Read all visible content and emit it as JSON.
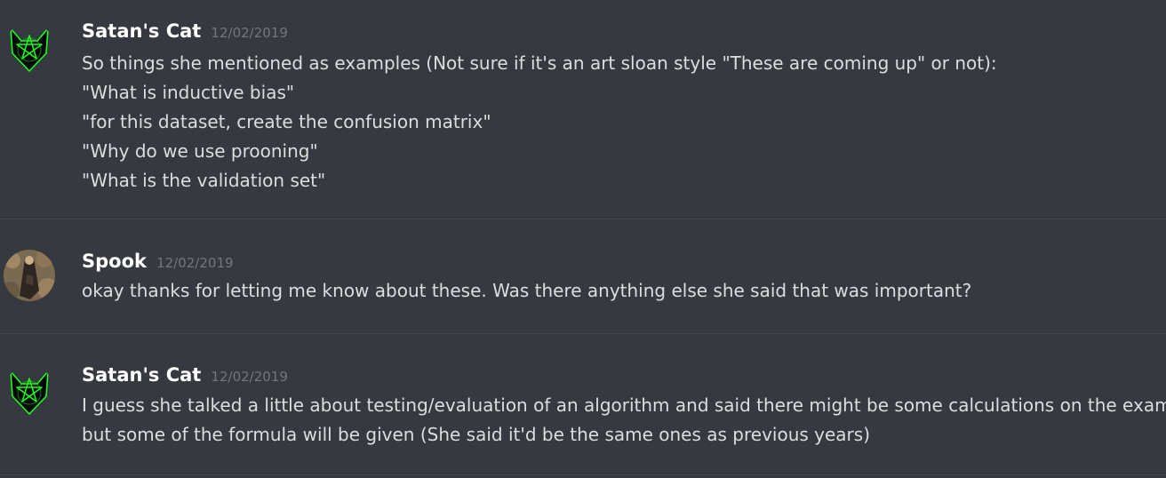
{
  "messages": [
    {
      "author": "Satan's Cat",
      "timestamp": "12/02/2019",
      "avatar_icon": "green-pentagram-cat-icon",
      "lines": [
        "So things she mentioned as examples (Not sure if it's an art sloan style \"These are coming up\" or not):",
        "\"What is inductive bias\"",
        "\"for this dataset, create the confusion matrix\"",
        "\"Why do we use prooning\"",
        "\"What is the validation set\""
      ]
    },
    {
      "author": "Spook",
      "timestamp": "12/02/2019",
      "avatar_icon": "spook-avatar-image",
      "lines": [
        "okay thanks for letting me know about these. Was there anything else she said that was important?"
      ]
    },
    {
      "author": "Satan's Cat",
      "timestamp": "12/02/2019",
      "avatar_icon": "green-pentagram-cat-icon",
      "lines": [
        "I guess she talked a little about testing/evaluation of an algorithm and said there might be some calculations on the exam,",
        "but some of the formula will be given (She said it'd be the same ones as previous years)"
      ]
    }
  ],
  "colors": {
    "background": "#36393f",
    "username": "#ffffff",
    "timestamp": "#72767d",
    "text": "#dcddde",
    "divider": "#42454a",
    "cat_avatar_accent": "#1aff1a"
  }
}
